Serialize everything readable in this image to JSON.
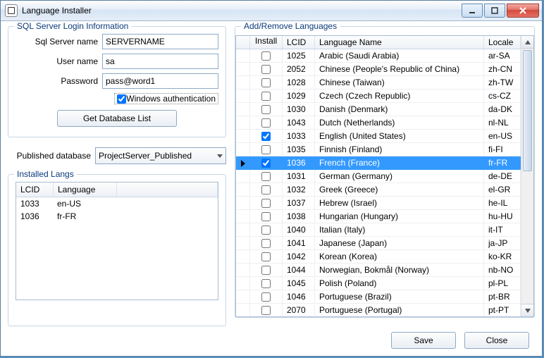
{
  "window": {
    "title": "Language Installer"
  },
  "login": {
    "legend": "SQL Server Login Information",
    "server_label": "Sql Server name",
    "server_value": "SERVERNAME",
    "user_label": "User name",
    "user_value": "sa",
    "pass_label": "Password",
    "pass_value": "pass@word1",
    "winauth_label": "Windows authentication",
    "getdb_label": "Get Database List",
    "pubdb_label": "Published database",
    "pubdb_value": "ProjectServer_Published"
  },
  "installed": {
    "legend": "Installed Langs",
    "col_lcid": "LCID",
    "col_lang": "Language",
    "rows": [
      {
        "lcid": "1033",
        "lang": "en-US"
      },
      {
        "lcid": "1036",
        "lang": "fr-FR"
      }
    ]
  },
  "addremove": {
    "legend": "Add/Remove Languages",
    "col_install": "Install",
    "col_lcid": "LCID",
    "col_name": "Language Name",
    "col_locale": "Locale",
    "rows": [
      {
        "install": false,
        "lcid": "1025",
        "name": "Arabic (Saudi Arabia)",
        "locale": "ar-SA",
        "selected": false
      },
      {
        "install": false,
        "lcid": "2052",
        "name": "Chinese (People's Republic of China)",
        "locale": "zh-CN",
        "selected": false
      },
      {
        "install": false,
        "lcid": "1028",
        "name": "Chinese (Taiwan)",
        "locale": "zh-TW",
        "selected": false
      },
      {
        "install": false,
        "lcid": "1029",
        "name": "Czech (Czech Republic)",
        "locale": "cs-CZ",
        "selected": false
      },
      {
        "install": false,
        "lcid": "1030",
        "name": "Danish (Denmark)",
        "locale": "da-DK",
        "selected": false
      },
      {
        "install": false,
        "lcid": "1043",
        "name": "Dutch (Netherlands)",
        "locale": "nl-NL",
        "selected": false
      },
      {
        "install": true,
        "lcid": "1033",
        "name": "English (United States)",
        "locale": "en-US",
        "selected": false
      },
      {
        "install": false,
        "lcid": "1035",
        "name": "Finnish (Finland)",
        "locale": "fi-FI",
        "selected": false
      },
      {
        "install": true,
        "lcid": "1036",
        "name": "French (France)",
        "locale": "fr-FR",
        "selected": true
      },
      {
        "install": false,
        "lcid": "1031",
        "name": "German (Germany)",
        "locale": "de-DE",
        "selected": false
      },
      {
        "install": false,
        "lcid": "1032",
        "name": "Greek (Greece)",
        "locale": "el-GR",
        "selected": false
      },
      {
        "install": false,
        "lcid": "1037",
        "name": "Hebrew (Israel)",
        "locale": "he-IL",
        "selected": false
      },
      {
        "install": false,
        "lcid": "1038",
        "name": "Hungarian (Hungary)",
        "locale": "hu-HU",
        "selected": false
      },
      {
        "install": false,
        "lcid": "1040",
        "name": "Italian (Italy)",
        "locale": "it-IT",
        "selected": false
      },
      {
        "install": false,
        "lcid": "1041",
        "name": "Japanese (Japan)",
        "locale": "ja-JP",
        "selected": false
      },
      {
        "install": false,
        "lcid": "1042",
        "name": "Korean (Korea)",
        "locale": "ko-KR",
        "selected": false
      },
      {
        "install": false,
        "lcid": "1044",
        "name": "Norwegian, Bokmål (Norway)",
        "locale": "nb-NO",
        "selected": false
      },
      {
        "install": false,
        "lcid": "1045",
        "name": "Polish (Poland)",
        "locale": "pl-PL",
        "selected": false
      },
      {
        "install": false,
        "lcid": "1046",
        "name": "Portuguese (Brazil)",
        "locale": "pt-BR",
        "selected": false
      },
      {
        "install": false,
        "lcid": "2070",
        "name": "Portuguese (Portugal)",
        "locale": "pt-PT",
        "selected": false
      }
    ]
  },
  "footer": {
    "save": "Save",
    "close": "Close"
  }
}
